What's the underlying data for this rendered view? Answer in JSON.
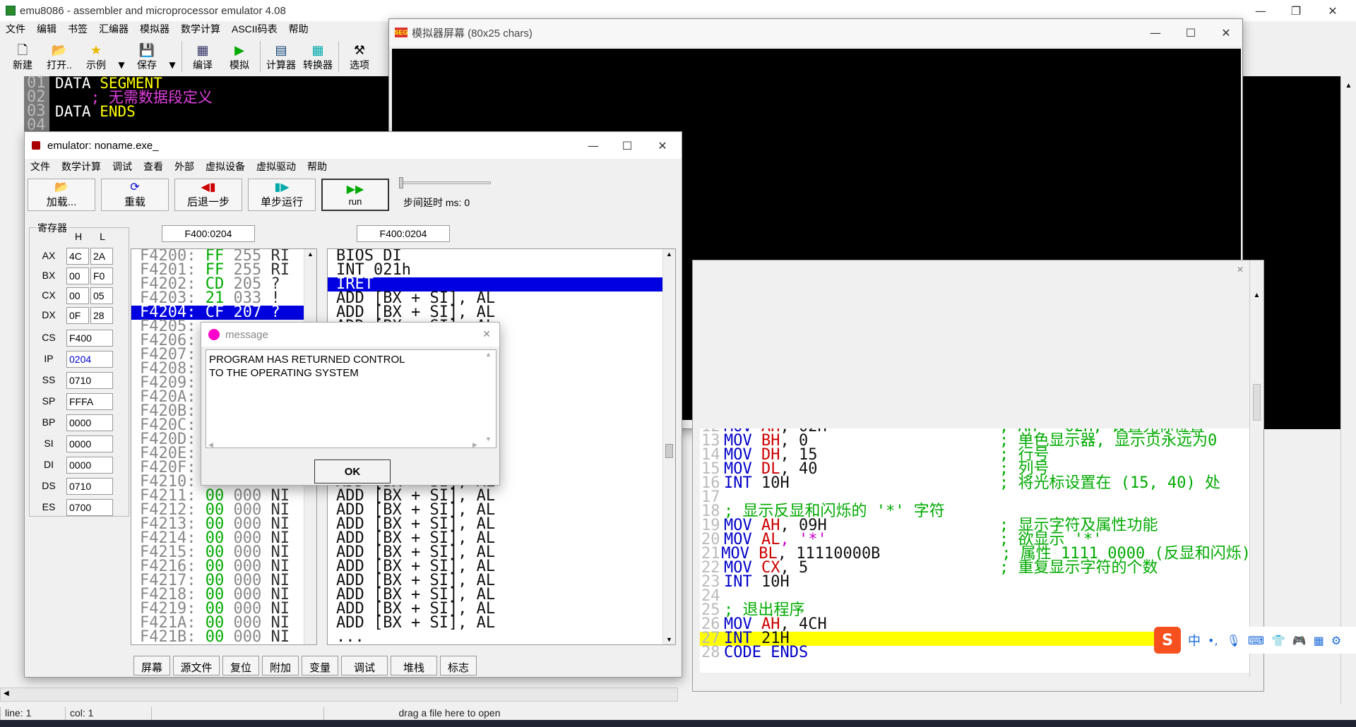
{
  "app": {
    "title": "emu8086 - assembler and microprocessor emulator 4.08"
  },
  "menu": [
    "文件",
    "编辑",
    "书签",
    "汇编器",
    "模拟器",
    "数学计算",
    "ASCII码表",
    "帮助"
  ],
  "toolbar": {
    "new": "新建",
    "open": "打开..",
    "examples": "示例",
    "save": "保存",
    "compile": "编译",
    "emulate": "模拟",
    "calculator": "计算器",
    "converter": "转换器",
    "options": "选项"
  },
  "editor": {
    "lines": [
      {
        "num": "01",
        "text": "DATA",
        "kw": "SEGMENT"
      },
      {
        "num": "02",
        "text": "    ; 无需数据段定义",
        "kw": ""
      },
      {
        "num": "03",
        "text": "DATA",
        "kw": "ENDS"
      },
      {
        "num": "04",
        "text": "",
        "kw": ""
      }
    ]
  },
  "emulator": {
    "title": "emulator: noname.exe_",
    "menu": [
      "文件",
      "数学计算",
      "调试",
      "查看",
      "外部",
      "虚拟设备",
      "虚拟驱动",
      "帮助"
    ],
    "buttons": {
      "load": "加载...",
      "reload": "重载",
      "back": "后退一步",
      "step": "单步运行",
      "run": "run"
    },
    "delay_label": "步间延时 ms: 0",
    "registers_title": "寄存器",
    "h_label": "H",
    "l_label": "L",
    "registers_hl": [
      {
        "name": "AX",
        "h": "4C",
        "l": "2A"
      },
      {
        "name": "BX",
        "h": "00",
        "l": "F0"
      },
      {
        "name": "CX",
        "h": "00",
        "l": "05"
      },
      {
        "name": "DX",
        "h": "0F",
        "l": "28"
      }
    ],
    "registers": [
      {
        "name": "CS",
        "value": "F400"
      },
      {
        "name": "IP",
        "value": "0204"
      },
      {
        "name": "SS",
        "value": "0710"
      },
      {
        "name": "SP",
        "value": "FFFA"
      },
      {
        "name": "BP",
        "value": "0000"
      },
      {
        "name": "SI",
        "value": "0000"
      },
      {
        "name": "DI",
        "value": "0000"
      },
      {
        "name": "DS",
        "value": "0710"
      },
      {
        "name": "ES",
        "value": "0700"
      }
    ],
    "address_left": "F400:0204",
    "address_right": "F400:0204",
    "memory": [
      {
        "addr": "F4200:",
        "hex": "FF",
        "dec": "255",
        "ch": "RI"
      },
      {
        "addr": "F4201:",
        "hex": "FF",
        "dec": "255",
        "ch": "RI"
      },
      {
        "addr": "F4202:",
        "hex": "CD",
        "dec": "205",
        "ch": "?"
      },
      {
        "addr": "F4203:",
        "hex": "21",
        "dec": "033",
        "ch": "!"
      },
      {
        "addr": "F4204:",
        "hex": "CF",
        "dec": "207",
        "ch": "?",
        "sel": true
      },
      {
        "addr": "F4205:",
        "hex": "",
        "dec": "",
        "ch": ""
      },
      {
        "addr": "F4206:",
        "hex": "",
        "dec": "",
        "ch": ""
      },
      {
        "addr": "F4207:",
        "hex": "",
        "dec": "",
        "ch": ""
      },
      {
        "addr": "F4208:",
        "hex": "",
        "dec": "",
        "ch": ""
      },
      {
        "addr": "F4209:",
        "hex": "",
        "dec": "",
        "ch": ""
      },
      {
        "addr": "F420A:",
        "hex": "",
        "dec": "",
        "ch": ""
      },
      {
        "addr": "F420B:",
        "hex": "",
        "dec": "",
        "ch": ""
      },
      {
        "addr": "F420C:",
        "hex": "",
        "dec": "",
        "ch": ""
      },
      {
        "addr": "F420D:",
        "hex": "",
        "dec": "",
        "ch": ""
      },
      {
        "addr": "F420E:",
        "hex": "",
        "dec": "",
        "ch": ""
      },
      {
        "addr": "F420F:",
        "hex": "",
        "dec": "",
        "ch": ""
      },
      {
        "addr": "F4210:",
        "hex": "",
        "dec": "",
        "ch": ""
      },
      {
        "addr": "F4211:",
        "hex": "00",
        "dec": "000",
        "ch": "NI"
      },
      {
        "addr": "F4212:",
        "hex": "00",
        "dec": "000",
        "ch": "NI"
      },
      {
        "addr": "F4213:",
        "hex": "00",
        "dec": "000",
        "ch": "NI"
      },
      {
        "addr": "F4214:",
        "hex": "00",
        "dec": "000",
        "ch": "NI"
      },
      {
        "addr": "F4215:",
        "hex": "00",
        "dec": "000",
        "ch": "NI"
      },
      {
        "addr": "F4216:",
        "hex": "00",
        "dec": "000",
        "ch": "NI"
      },
      {
        "addr": "F4217:",
        "hex": "00",
        "dec": "000",
        "ch": "NI"
      },
      {
        "addr": "F4218:",
        "hex": "00",
        "dec": "000",
        "ch": "NI"
      },
      {
        "addr": "F4219:",
        "hex": "00",
        "dec": "000",
        "ch": "NI"
      },
      {
        "addr": "F421A:",
        "hex": "00",
        "dec": "000",
        "ch": "NI"
      },
      {
        "addr": "F421B:",
        "hex": "00",
        "dec": "000",
        "ch": "NI"
      }
    ],
    "disasm": [
      "BIOS DI",
      "INT 021h",
      "IRET",
      "ADD [BX + SI], AL",
      "ADD [BX + SI], AL",
      "ADD [BX + SI], AL",
      "ADD [BX + SI], AL",
      "ADD [BX + SI], AL",
      "ADD [BX + SI], AL",
      "ADD [BX + SI], AL",
      "ADD [BX + SI], AL",
      "ADD [BX + SI], AL",
      "ADD [BX + SI], AL",
      "ADD [BX + SI], AL",
      "ADD [BX + SI], AL",
      "ADD [BX + SI], AL",
      "ADD [BX + SI], AL",
      "ADD [BX + SI], AL",
      "ADD [BX + SI], AL",
      "ADD [BX + SI], AL",
      "ADD [BX + SI], AL",
      "ADD [BX + SI], AL",
      "ADD [BX + SI], AL",
      "ADD [BX + SI], AL",
      "ADD [BX + SI], AL",
      "ADD [BX + SI], AL",
      "ADD [BX + SI], AL",
      "..."
    ],
    "bottom_buttons": [
      "屏幕",
      "源文件",
      "复位",
      "附加",
      "变量",
      "调试",
      "堆栈",
      "标志"
    ]
  },
  "screen": {
    "title": "模拟器屏幕 (80x25 chars)",
    "output": "*****"
  },
  "source": {
    "lines": [
      {
        "n": "12",
        "op": "MOV",
        "r": "AH",
        "v": ", 02H",
        "c": "; AH = 02H, 设置光标位置"
      },
      {
        "n": "13",
        "op": "MOV",
        "r": "BH",
        "v": ", 0",
        "c": "; 单色显示器, 显示页永远为0"
      },
      {
        "n": "14",
        "op": "MOV",
        "r": "DH",
        "v": ", 15",
        "c": "; 行号"
      },
      {
        "n": "15",
        "op": "MOV",
        "r": "DL",
        "v": ", 40",
        "c": "; 列号"
      },
      {
        "n": "16",
        "op": "INT",
        "r": "",
        "v": " 10H",
        "c": "; 将光标设置在 (15, 40) 处"
      },
      {
        "n": "17",
        "op": "",
        "r": "",
        "v": "",
        "c": ""
      },
      {
        "n": "18",
        "op": "",
        "r": "",
        "v": "",
        "c": "; 显示反显和闪烁的 '*' 字符"
      },
      {
        "n": "19",
        "op": "MOV",
        "r": "AH",
        "v": ", 09H",
        "c": "; 显示字符及属性功能"
      },
      {
        "n": "20",
        "op": "MOV",
        "r": "AL",
        "v": ", '*'",
        "c": "; 欲显示 '*'"
      },
      {
        "n": "21",
        "op": "MOV",
        "r": "BL",
        "v": ", 11110000B",
        "c": "    ; 属性 1111 0000 (反显和闪烁)"
      },
      {
        "n": "22",
        "op": "MOV",
        "r": "CX",
        "v": ", 5",
        "c": "; 重复显示字符的个数"
      },
      {
        "n": "23",
        "op": "INT",
        "r": "",
        "v": " 10H",
        "c": ""
      },
      {
        "n": "24",
        "op": "",
        "r": "",
        "v": "",
        "c": ""
      },
      {
        "n": "25",
        "op": "",
        "r": "",
        "v": "",
        "c": "; 退出程序"
      },
      {
        "n": "26",
        "op": "MOV",
        "r": "AH",
        "v": ", 4CH",
        "c": ""
      },
      {
        "n": "27",
        "op": "INT",
        "r": "",
        "v": " 21H",
        "c": "",
        "hl": true
      },
      {
        "n": "28",
        "op": "CODE",
        "r": "",
        "v": " ENDS",
        "c": ""
      }
    ]
  },
  "ime": {
    "logo": "S",
    "mode": "中"
  },
  "message": {
    "title": "message",
    "text": "PROGRAM HAS RETURNED CONTROL\nTO THE OPERATING SYSTEM",
    "ok": "OK"
  },
  "status": {
    "line": "line: 1",
    "col": "col: 1",
    "hint": "drag a file here to open"
  },
  "colors": {
    "selection": "#0000e0",
    "highlight": "#ffff00",
    "keyword": "#0000c8",
    "register": "#c00000",
    "comment": "#00a000"
  }
}
